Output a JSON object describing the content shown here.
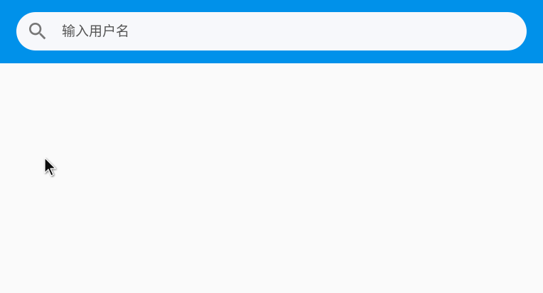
{
  "search": {
    "placeholder": "输入用户名",
    "value": "",
    "icon": "search-icon"
  },
  "colors": {
    "app_bar": "#0091ea",
    "search_box": "#f7f8fb",
    "background": "#fafafa",
    "icon": "#777777"
  }
}
